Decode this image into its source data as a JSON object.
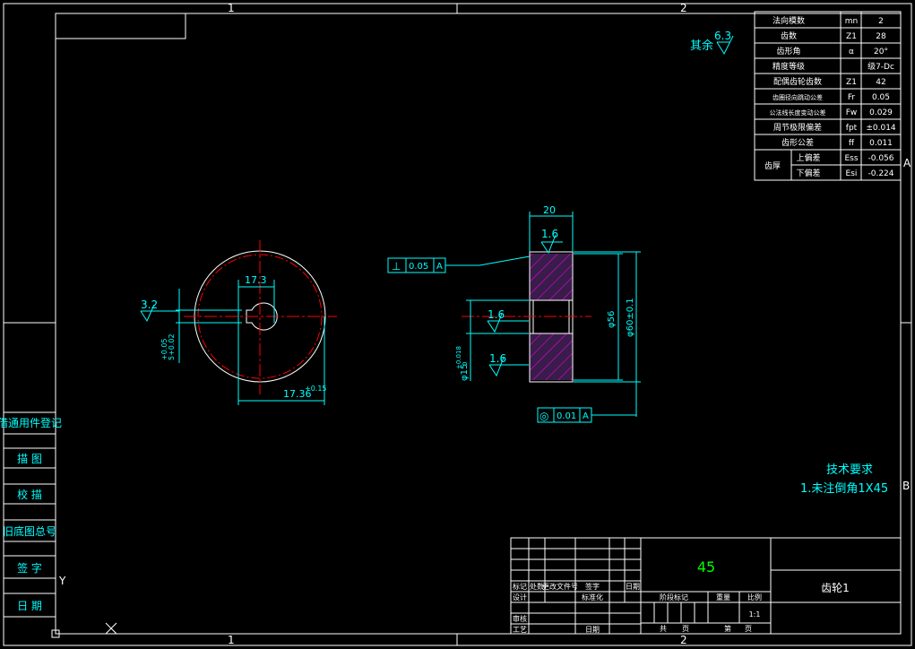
{
  "colors": {
    "background": "#000000",
    "frame": "#ffffff",
    "dimension": "#00ffff",
    "centerline": "#ff0000",
    "hatch": "#ff00ff",
    "text_title": "#00ff00",
    "table_text": "#ffffff"
  },
  "zones": {
    "top_1": "1",
    "top_2": "2",
    "bottom_1": "1",
    "bottom_2": "2",
    "right_a": "A",
    "right_b": "B"
  },
  "roughness": {
    "other_label": "其余",
    "other_value": "6.3",
    "keyway_value": "3.2",
    "face_top": "1.6",
    "bore": "1.6",
    "face_bottom": "1.6"
  },
  "dims": {
    "keyway_width": "17.3",
    "keyway_depth": "17.36",
    "keyway_depth_tol": "+0.15",
    "key_width_tol_upper": "+0.05",
    "key_width_tol_lower": "5+0.02",
    "thickness": "20",
    "hub_dia": "φ56",
    "outer_dia": "φ60±0.1",
    "bore_dia": "φ15",
    "bore_tol": "+0.018",
    "bore_tol_low": "0"
  },
  "tolerances": {
    "perp": {
      "symbol": "⊥",
      "value": "0.05",
      "datum": "A"
    },
    "conc": {
      "symbol": "◎",
      "value": "0.01",
      "datum": "A"
    }
  },
  "param_table": [
    {
      "name": "法向模数",
      "sym": "mn",
      "val": "2"
    },
    {
      "name": "齿数",
      "sym": "Z1",
      "val": "28"
    },
    {
      "name": "齿形角",
      "sym": "α",
      "val": "20°"
    },
    {
      "name": "精度等级",
      "sym": "",
      "val": "级7-Dc"
    },
    {
      "name": "配偶齿轮齿数",
      "sym": "Z1",
      "val": "42"
    },
    {
      "name": "齿圈径向跳动公差",
      "sym": "Fr",
      "val": "0.05"
    },
    {
      "name": "公法线长度变动公差",
      "sym": "Fw",
      "val": "0.029"
    },
    {
      "name": "周节极限偏差",
      "sym": "fpt",
      "val": "±0.014"
    },
    {
      "name": "齿形公差",
      "sym": "ff",
      "val": "0.011"
    }
  ],
  "thickness_row": {
    "group": "齿厚",
    "upper_label": "上偏差",
    "upper_sym": "Ess",
    "upper_val": "-0.056",
    "lower_label": "下偏差",
    "lower_sym": "Esi",
    "lower_val": "-0.224"
  },
  "tech_req": {
    "title": "技术要求",
    "item1": "1.未注倒角1X45"
  },
  "side_labels": [
    "借通用件登记",
    "描 图",
    "校 描",
    "旧底图总号",
    "签 字",
    "日 期"
  ],
  "title_block": {
    "material": "45",
    "part_name": "齿轮1",
    "scale": "1:1",
    "row_labels": [
      "标记",
      "处数",
      "更改文件号",
      "签字",
      "日期"
    ],
    "design": "设计",
    "standardize": "标准化",
    "review": "审核",
    "process": "工艺",
    "date": "日期",
    "stage_mark": "阶段标记",
    "weight": "重量",
    "ratio": "比例",
    "total_sheets": "共",
    "sheets_unit": "页",
    "sheet_no": "第",
    "sheet_unit": "页"
  },
  "ucs": {
    "y": "Y"
  }
}
